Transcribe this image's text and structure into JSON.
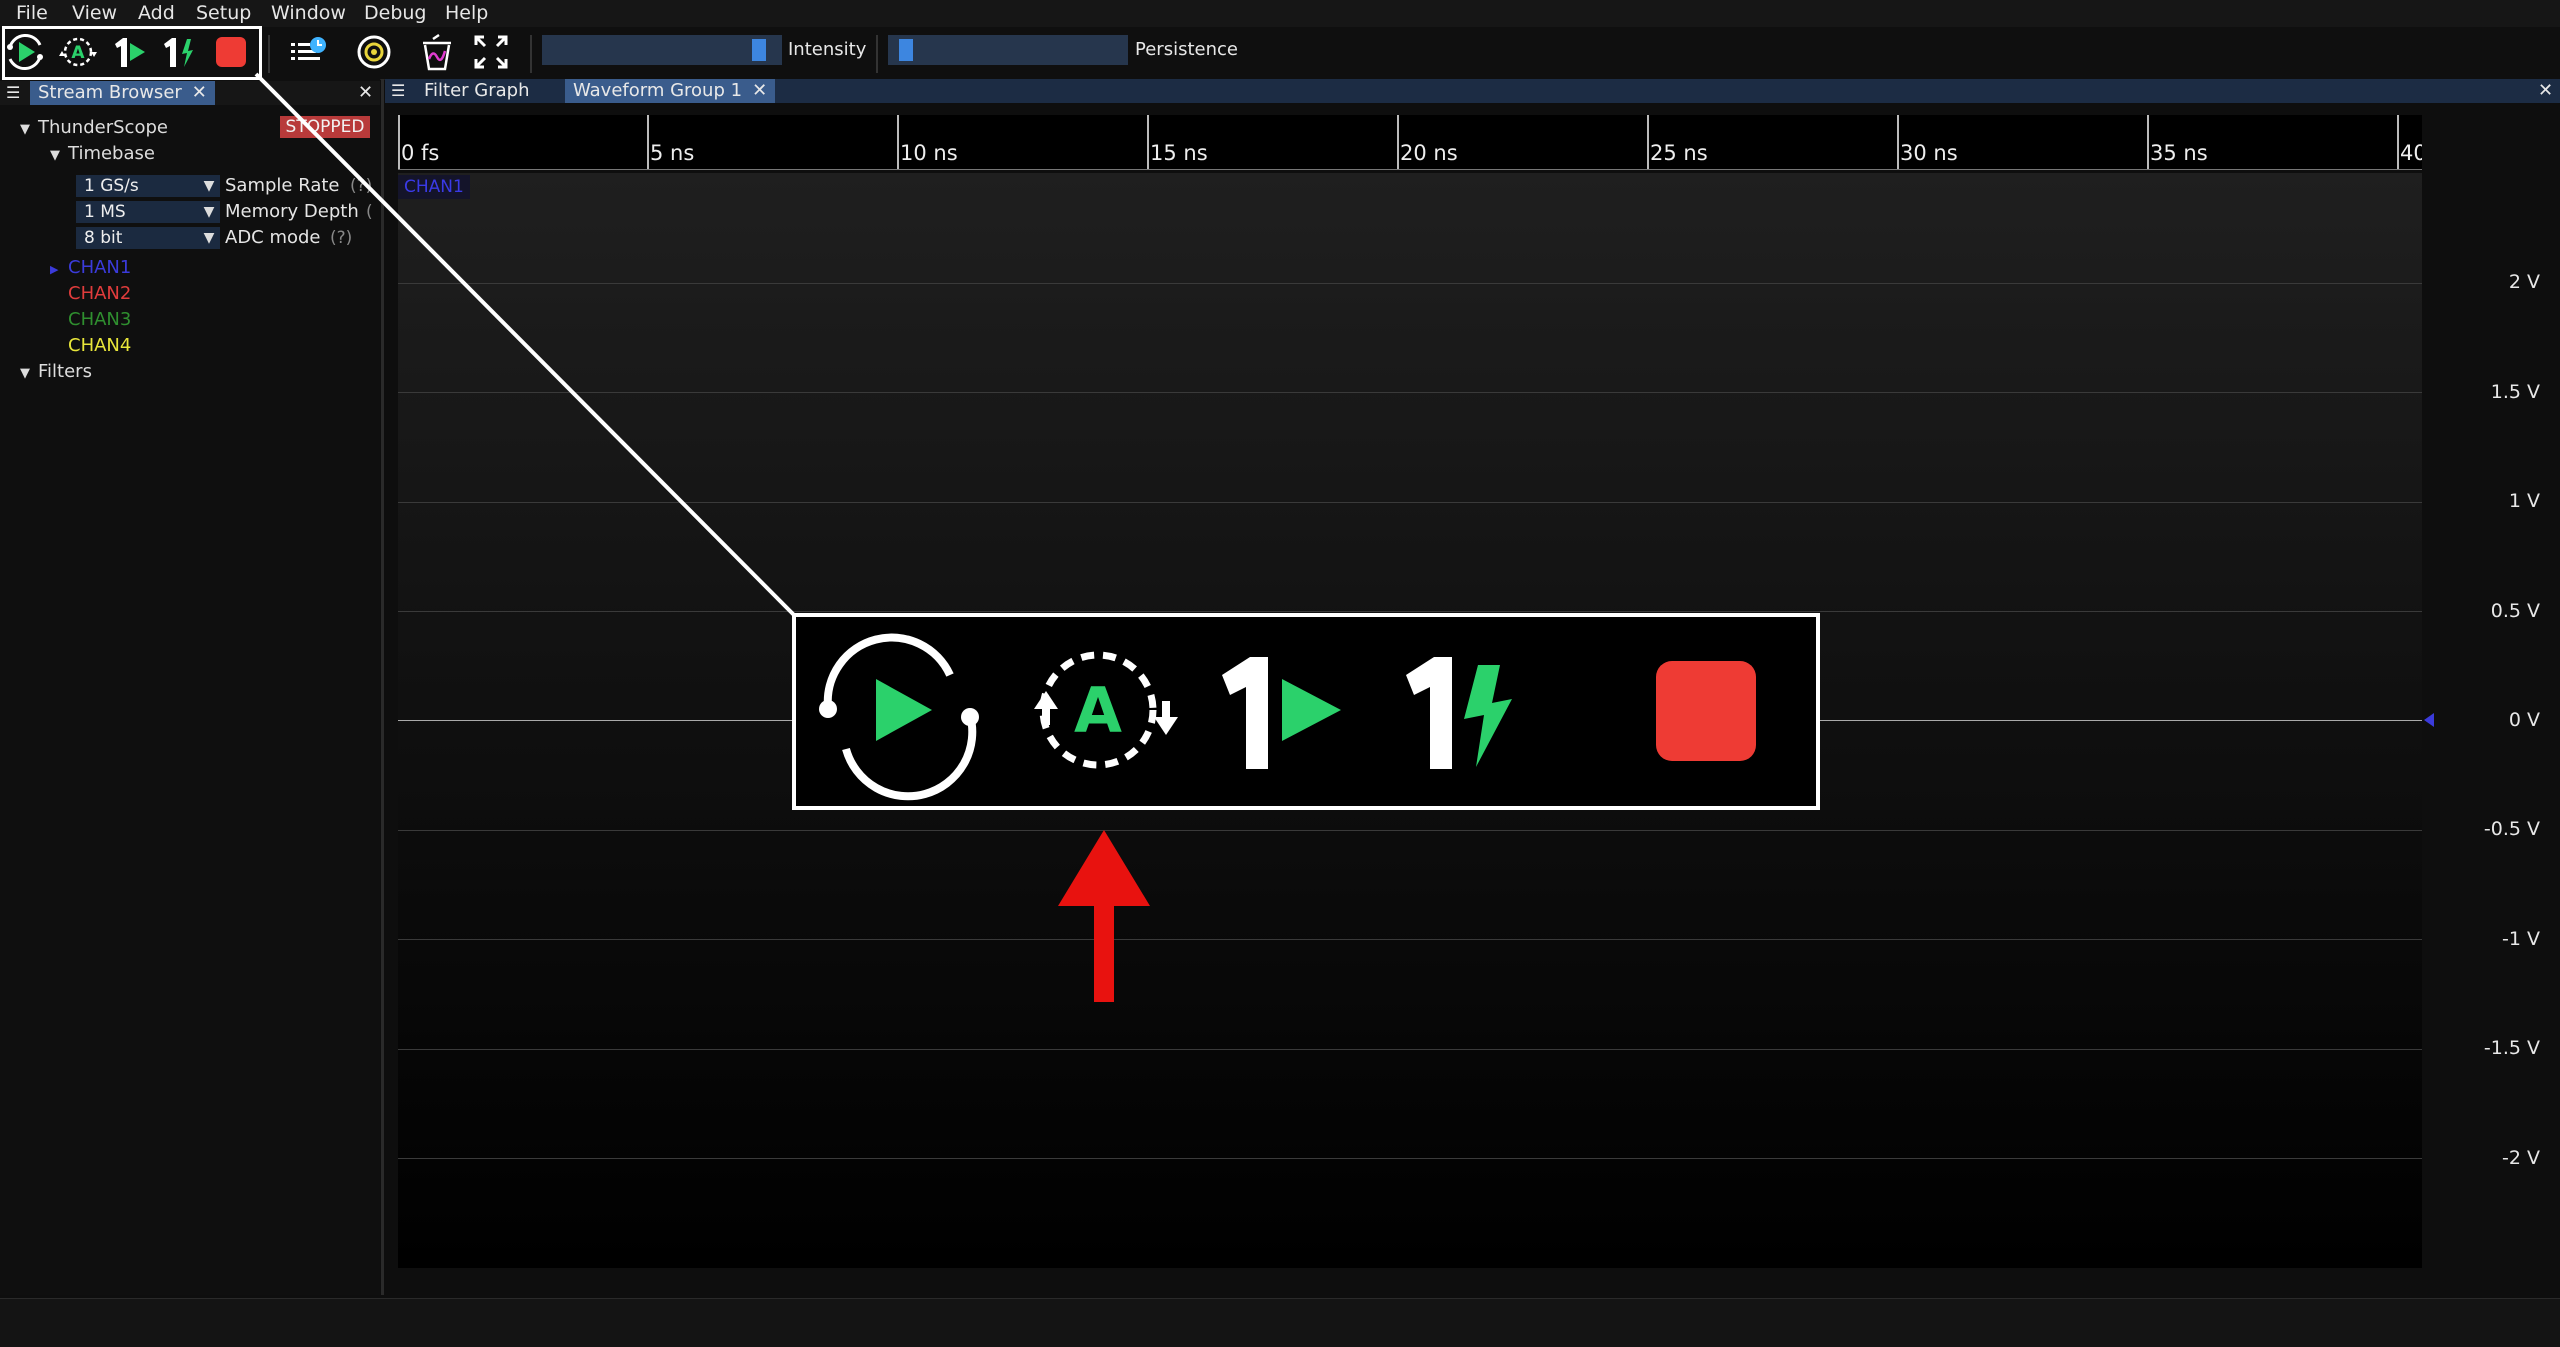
{
  "menu": [
    "File",
    "View",
    "Add",
    "Setup",
    "Window",
    "Debug",
    "Help"
  ],
  "toolbar": {
    "buttons": [
      "start-acquisition",
      "auto-trigger",
      "single-trigger",
      "force-trigger",
      "stop-acquisition",
      "history",
      "preferences",
      "clear-sweeps",
      "fullscreen"
    ],
    "intensity_label": "Intensity",
    "persistence_label": "Persistence",
    "intensity_value": 0.93,
    "persistence_value": 0.05
  },
  "left_panel": {
    "tab_label": "Stream Browser",
    "instrument": "ThunderScope",
    "status": "STOPPED",
    "timebase_label": "Timebase",
    "params": [
      {
        "value": "1 GS/s",
        "label": "Sample Rate",
        "help": "(?)"
      },
      {
        "value": "1 MS",
        "label": "Memory Depth",
        "help": "("
      },
      {
        "value": "8 bit",
        "label": "ADC mode",
        "help": "(?)"
      }
    ],
    "channels": [
      {
        "name": "CHAN1",
        "color": "#3b3bdb"
      },
      {
        "name": "CHAN2",
        "color": "#e03c3c"
      },
      {
        "name": "CHAN3",
        "color": "#2f8f2f"
      },
      {
        "name": "CHAN4",
        "color": "#e8e63a"
      }
    ],
    "filters_label": "Filters"
  },
  "wave_area": {
    "tab_filter_graph": "Filter Graph",
    "tab_waveform_group": "Waveform Group 1",
    "time_ticks": [
      "0 fs",
      "5 ns",
      "10 ns",
      "15 ns",
      "20 ns",
      "25 ns",
      "30 ns",
      "35 ns",
      "40"
    ],
    "volt_labels": [
      "2 V",
      "1.5 V",
      "1 V",
      "0.5 V",
      "0 V",
      "-0.5 V",
      "-1 V",
      "-1.5 V",
      "-2 V"
    ],
    "channel_badge": "CHAN1"
  },
  "colors": {
    "accent": "#3a5c8c",
    "run_green": "#2bd16b",
    "stop_red": "#ee3b34",
    "arrow_red": "#e8120f"
  }
}
